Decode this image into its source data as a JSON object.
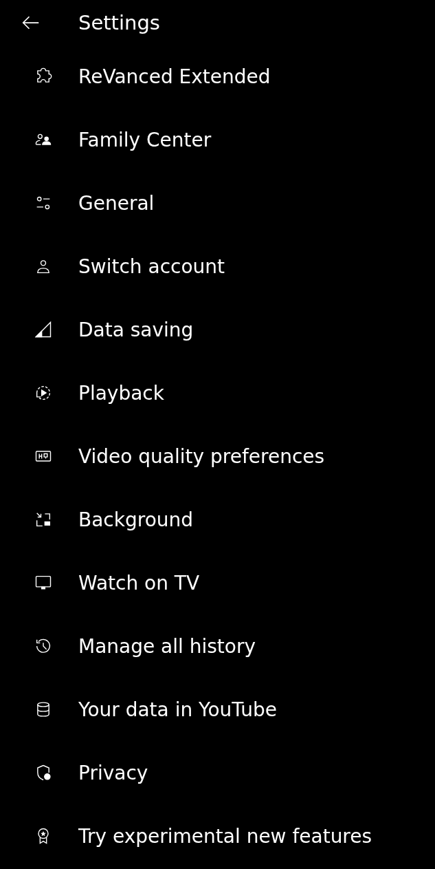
{
  "header": {
    "title": "Settings"
  },
  "items": [
    {
      "label": "ReVanced Extended"
    },
    {
      "label": "Family Center"
    },
    {
      "label": "General"
    },
    {
      "label": "Switch account"
    },
    {
      "label": "Data saving"
    },
    {
      "label": "Playback"
    },
    {
      "label": "Video quality preferences"
    },
    {
      "label": "Background"
    },
    {
      "label": "Watch on TV"
    },
    {
      "label": "Manage all history"
    },
    {
      "label": "Your data in YouTube"
    },
    {
      "label": "Privacy"
    },
    {
      "label": "Try experimental new features"
    }
  ]
}
